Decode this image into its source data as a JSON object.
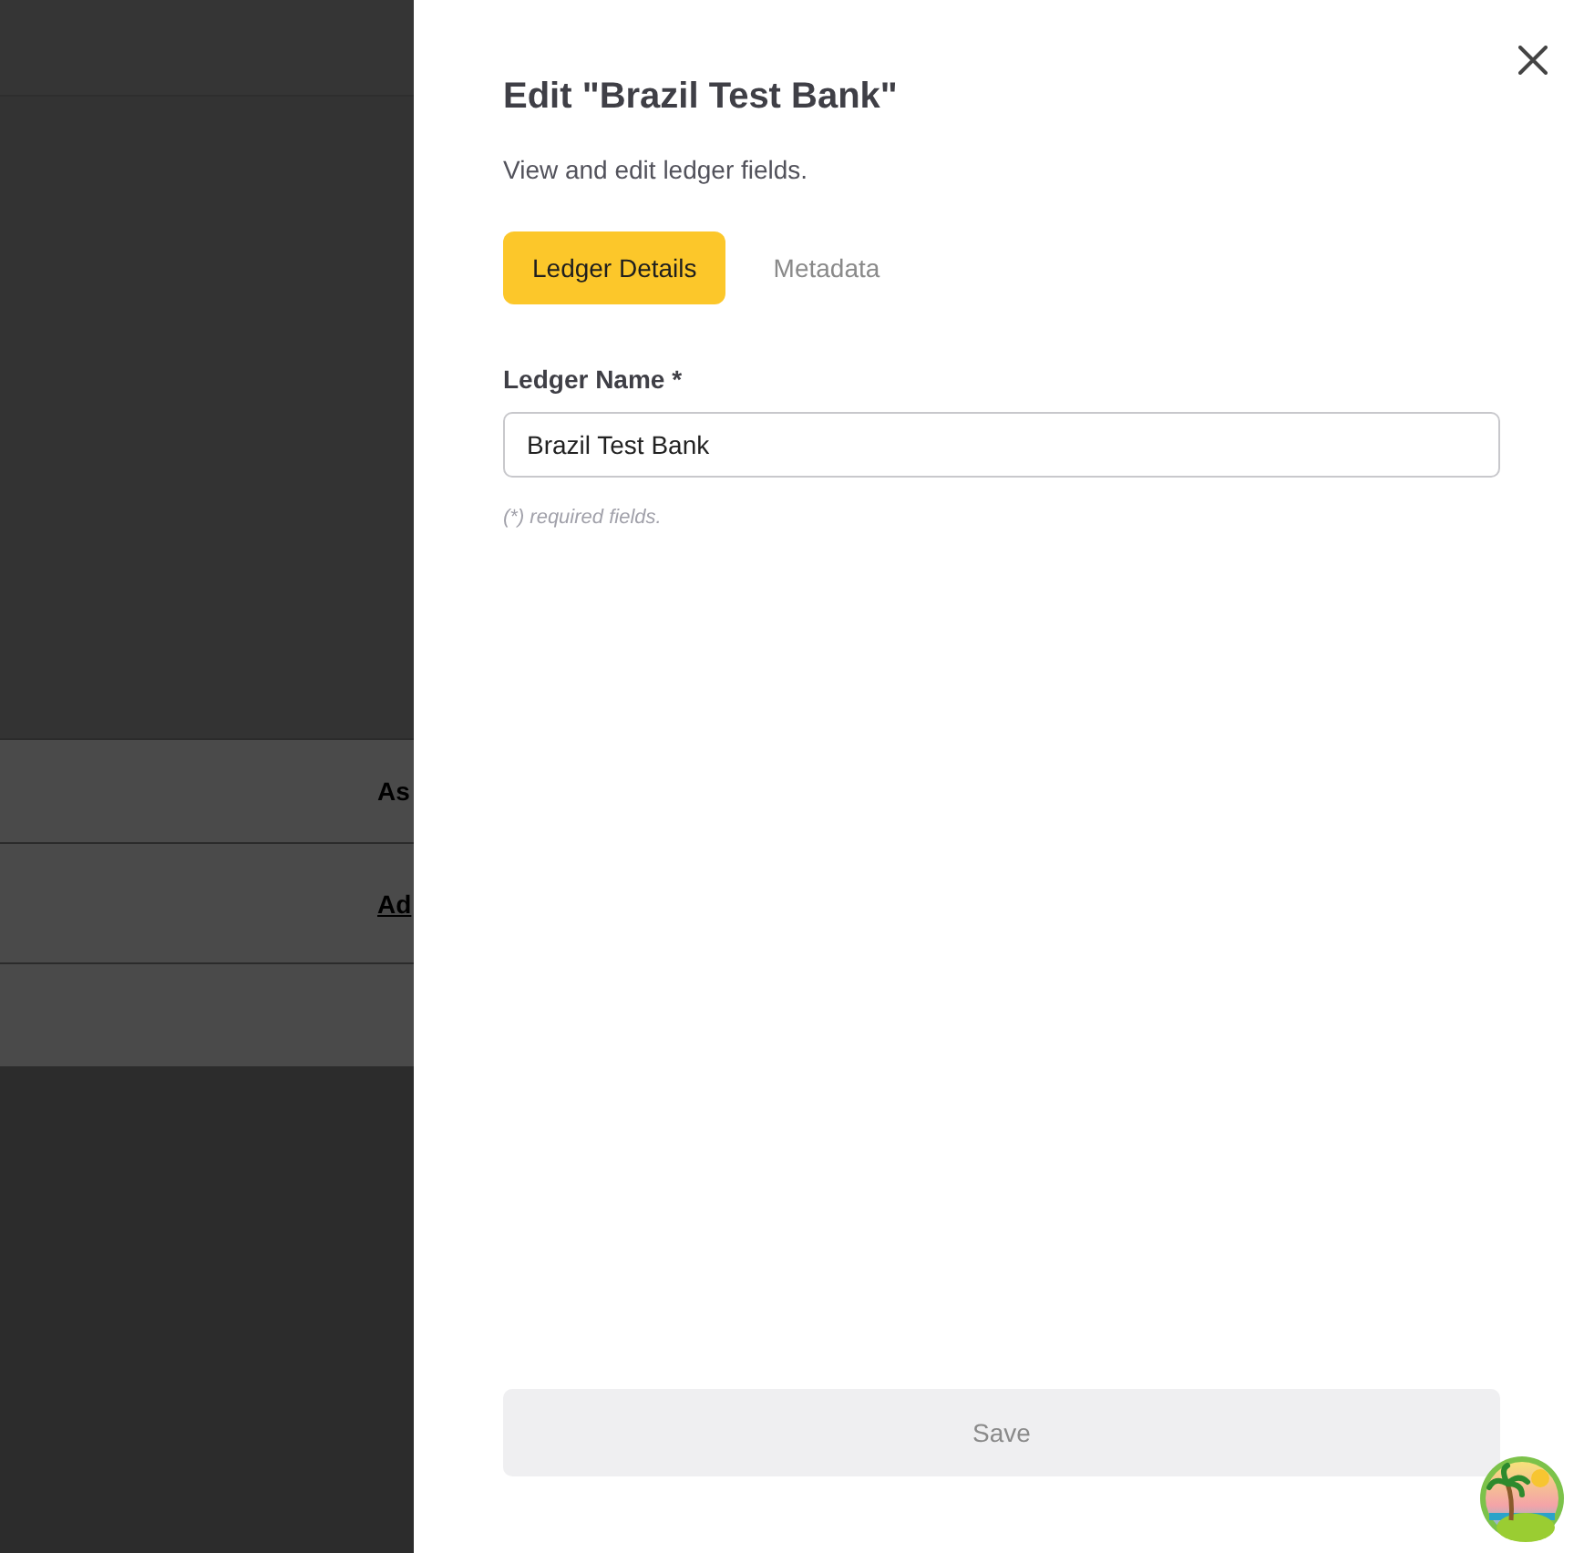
{
  "background": {
    "rows": [
      {
        "kind": "text",
        "text": "As"
      },
      {
        "kind": "link",
        "text": "Ad"
      },
      {
        "kind": "empty"
      }
    ]
  },
  "drawer": {
    "title": "Edit \"Brazil Test Bank\"",
    "subtitle": "View and edit ledger fields.",
    "tabs": [
      {
        "label": "Ledger Details",
        "selected": true
      },
      {
        "label": "Metadata",
        "selected": false
      }
    ],
    "field": {
      "label": "Ledger Name *",
      "value": "Brazil Test Bank"
    },
    "note": "(*) required fields.",
    "save": {
      "label": "Save",
      "disabled": true
    }
  }
}
